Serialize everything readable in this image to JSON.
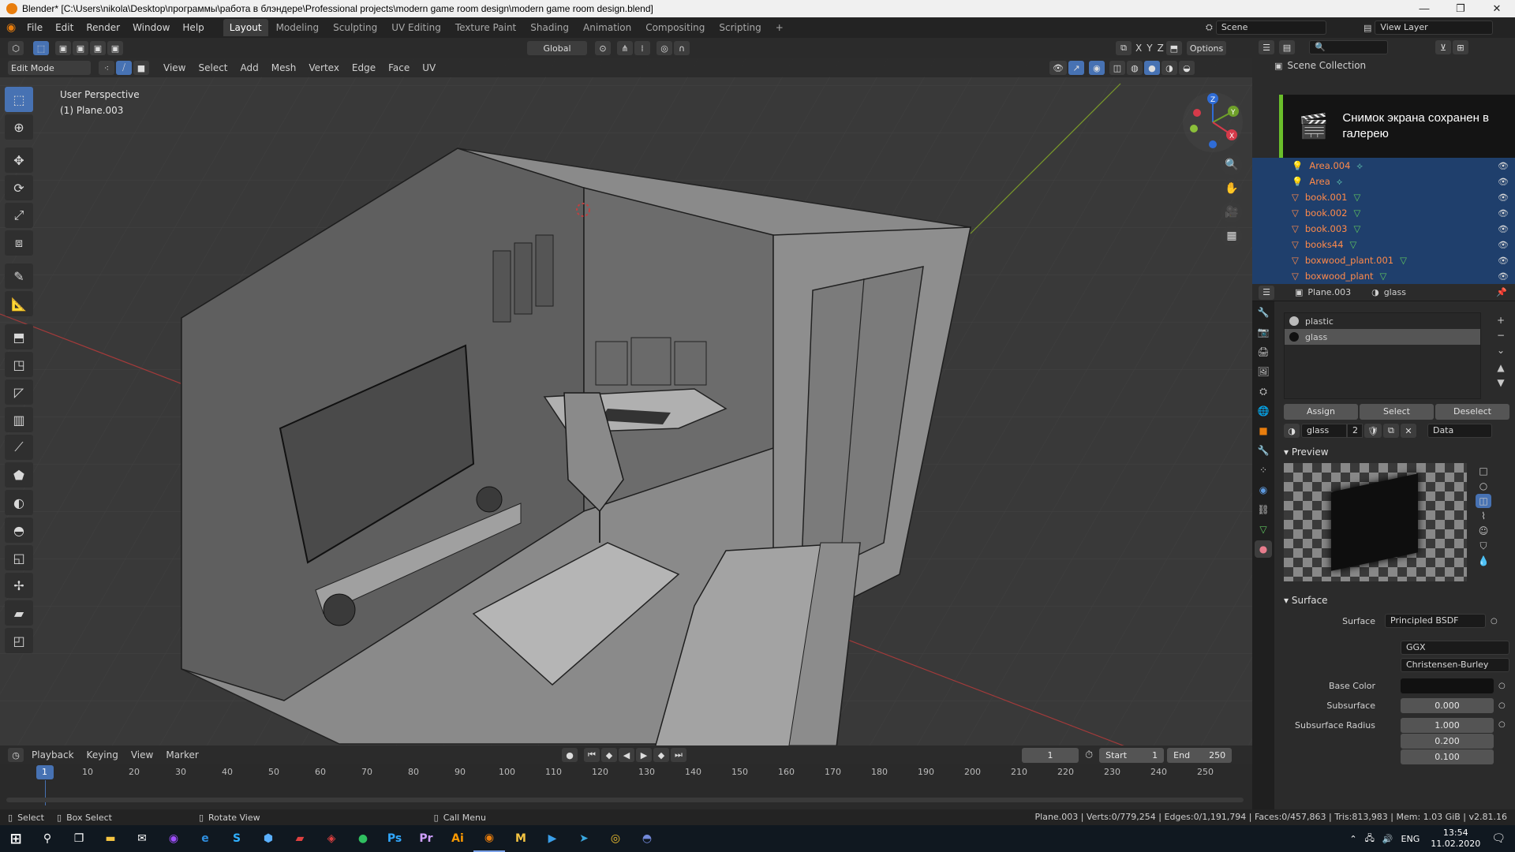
{
  "window": {
    "title": "Blender* [C:\\Users\\nikola\\Desktop\\программы\\работа в блэндере\\Professional projects\\modern game room design\\modern game room design.blend]",
    "minimize": "—",
    "maximize": "❐",
    "close": "✕"
  },
  "menu": {
    "items": [
      "File",
      "Edit",
      "Render",
      "Window",
      "Help"
    ],
    "workspaces": [
      "Layout",
      "Modeling",
      "Sculpting",
      "UV Editing",
      "Texture Paint",
      "Shading",
      "Animation",
      "Compositing",
      "Scripting"
    ],
    "active_workspace": "Layout",
    "add_tab": "+",
    "scene": "Scene",
    "view_layer": "View Layer"
  },
  "viewport": {
    "mode": "Edit Mode",
    "header_menus": [
      "View",
      "Select",
      "Add",
      "Mesh",
      "Vertex",
      "Edge",
      "Face",
      "UV"
    ],
    "transform_orientation": "Global",
    "options": "Options",
    "axes": [
      "X",
      "Y",
      "Z"
    ],
    "perspective_label": "User Perspective",
    "object_label": "(1) Plane.003",
    "gizmo_axes": [
      "Z",
      "Y",
      "X"
    ],
    "colors": {
      "background": "#393939",
      "grid": "#444444",
      "x_axis": "#a33a3a",
      "y_axis": "#7a9a2a",
      "accent": "#4772b3"
    }
  },
  "notification": {
    "text": "Снимок экрана сохранен в галерею"
  },
  "outliner": {
    "title": "Scene Collection",
    "items": [
      {
        "name": "Area.004"
      },
      {
        "name": "Area"
      },
      {
        "name": "book.001"
      },
      {
        "name": "book.002"
      },
      {
        "name": "book.003"
      },
      {
        "name": "books44"
      },
      {
        "name": "boxwood_plant.001"
      },
      {
        "name": "boxwood_plant"
      }
    ]
  },
  "properties": {
    "object": "Plane.003",
    "material": "glass",
    "material_slots": [
      "plastic",
      "glass"
    ],
    "active_slot": "glass",
    "buttons": [
      "Assign",
      "Select",
      "Deselect"
    ],
    "material_field": "glass",
    "user_count": "2",
    "link": "Data",
    "preview_title": "Preview",
    "surface_title": "Surface",
    "surface_label": "Surface",
    "surface_value": "Principled BSDF",
    "distribution": "GGX",
    "subsurface_method": "Christensen-Burley",
    "base_color_label": "Base Color",
    "subsurface_label": "Subsurface",
    "subsurface_value": "0.000",
    "subsurface_radius_label": "Subsurface Radius",
    "subsurface_radius": [
      "1.000",
      "0.200",
      "0.100"
    ]
  },
  "timeline": {
    "menus": [
      "Playback",
      "Keying",
      "View",
      "Marker"
    ],
    "current_frame": "1",
    "start_label": "Start",
    "start": "1",
    "end_label": "End",
    "end": "250",
    "ruler": [
      "1",
      "10",
      "20",
      "30",
      "40",
      "50",
      "60",
      "70",
      "80",
      "90",
      "100",
      "110",
      "120",
      "130",
      "140",
      "150",
      "160",
      "170",
      "180",
      "190",
      "200",
      "210",
      "220",
      "230",
      "240",
      "250"
    ]
  },
  "statusbar": {
    "select": "Select",
    "box_select": "Box Select",
    "rotate": "Rotate View",
    "call_menu": "Call Menu",
    "stats": "Plane.003 | Verts:0/779,254 | Edges:0/1,191,794 | Faces:0/457,863 | Tris:813,983 | Mem: 1.03 GiB | v2.81.16"
  },
  "taskbar": {
    "lang": "ENG",
    "time": "13:54",
    "date": "11.02.2020",
    "apps": [
      "Ps",
      "Pr",
      "Ai",
      "M"
    ]
  }
}
